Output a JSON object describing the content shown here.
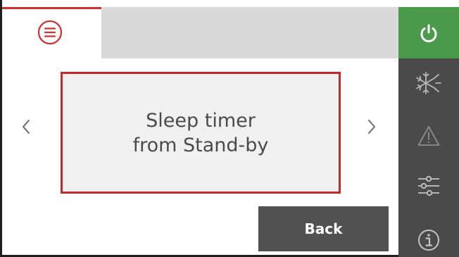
{
  "menu": {
    "icon": "hamburger-menu-icon",
    "accent_color": "#d32f2f"
  },
  "card": {
    "line1": "Sleep timer",
    "line2": "from Stand-by",
    "border_color": "#c62828"
  },
  "navigation": {
    "prev_icon": "chevron-left-icon",
    "next_icon": "chevron-right-icon"
  },
  "back_button": {
    "label": "Back"
  },
  "sidebar": {
    "items": [
      {
        "icon": "power-icon",
        "active": true,
        "color": "#4b9a4b"
      },
      {
        "icon": "fan-snowflake-sun-icon",
        "active": false
      },
      {
        "icon": "warning-icon",
        "active": false
      },
      {
        "icon": "sliders-icon",
        "active": false
      },
      {
        "icon": "info-icon",
        "active": false
      }
    ]
  }
}
